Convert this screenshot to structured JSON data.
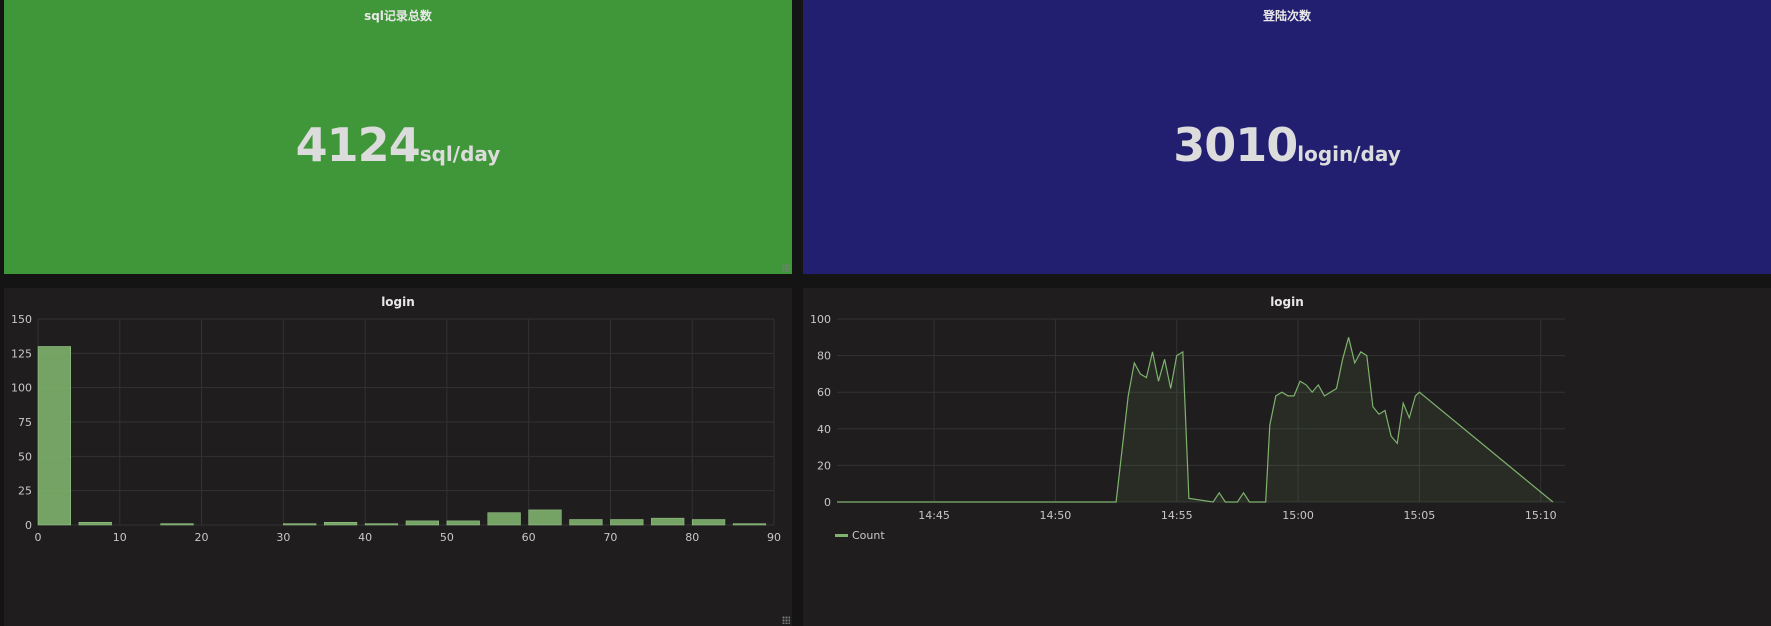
{
  "panels": {
    "sql": {
      "title": "sql记录总数",
      "value": "4124",
      "unit": "sql/day",
      "bg": "#3f973a"
    },
    "login_stat": {
      "title": "登陆次数",
      "value": "3010",
      "unit": "login/day",
      "bg": "#231f70"
    },
    "hist": {
      "title": "login"
    },
    "series": {
      "title": "login",
      "legend": "Count"
    }
  },
  "chart_data": [
    {
      "type": "bar",
      "title": "login",
      "color": "#7eb26d",
      "xlim": [
        0,
        90
      ],
      "ylim": [
        0,
        150
      ],
      "xticks": [
        0,
        10,
        20,
        30,
        40,
        50,
        60,
        70,
        80,
        90
      ],
      "yticks": [
        0,
        25,
        50,
        75,
        100,
        125,
        150
      ],
      "bin_width": 4,
      "bins": [
        0,
        5,
        15,
        30,
        35,
        40,
        45,
        50,
        55,
        60,
        65,
        70,
        75,
        80,
        85
      ],
      "values": [
        130,
        2,
        1,
        1,
        2,
        1,
        3,
        3,
        9,
        11,
        4,
        4,
        5,
        4,
        1
      ]
    },
    {
      "type": "area",
      "title": "login",
      "color": "#7eb26d",
      "ylim": [
        0,
        100
      ],
      "yticks": [
        0,
        20,
        40,
        60,
        80,
        100
      ],
      "xticks": [
        "14:45",
        "14:50",
        "14:55",
        "15:00",
        "15:05",
        "15:10"
      ],
      "series": [
        {
          "name": "Count",
          "x": [
            "14:41:00",
            "14:52:30",
            "14:53:00",
            "14:53:15",
            "14:53:30",
            "14:53:45",
            "14:54:00",
            "14:54:15",
            "14:54:30",
            "14:54:45",
            "14:55:00",
            "14:55:15",
            "14:55:30",
            "14:56:30",
            "14:56:45",
            "14:57:00",
            "14:57:30",
            "14:57:45",
            "14:58:00",
            "14:58:40",
            "14:58:50",
            "14:59:05",
            "14:59:20",
            "14:59:35",
            "14:59:50",
            "15:00:05",
            "15:00:20",
            "15:00:35",
            "15:00:50",
            "15:01:05",
            "15:01:20",
            "15:01:35",
            "15:01:50",
            "15:02:05",
            "15:02:20",
            "15:02:35",
            "15:02:50",
            "15:03:05",
            "15:03:20",
            "15:03:35",
            "15:03:50",
            "15:04:05",
            "15:04:20",
            "15:04:35",
            "15:04:50",
            "15:05:00",
            "15:10:30"
          ],
          "values": [
            0,
            0,
            58,
            76,
            70,
            68,
            82,
            66,
            78,
            62,
            80,
            82,
            2,
            0,
            5,
            0,
            0,
            5,
            0,
            0,
            42,
            58,
            60,
            58,
            58,
            66,
            64,
            60,
            64,
            58,
            60,
            62,
            78,
            90,
            76,
            82,
            80,
            52,
            48,
            50,
            36,
            32,
            54,
            46,
            58,
            60,
            0
          ]
        }
      ]
    }
  ]
}
